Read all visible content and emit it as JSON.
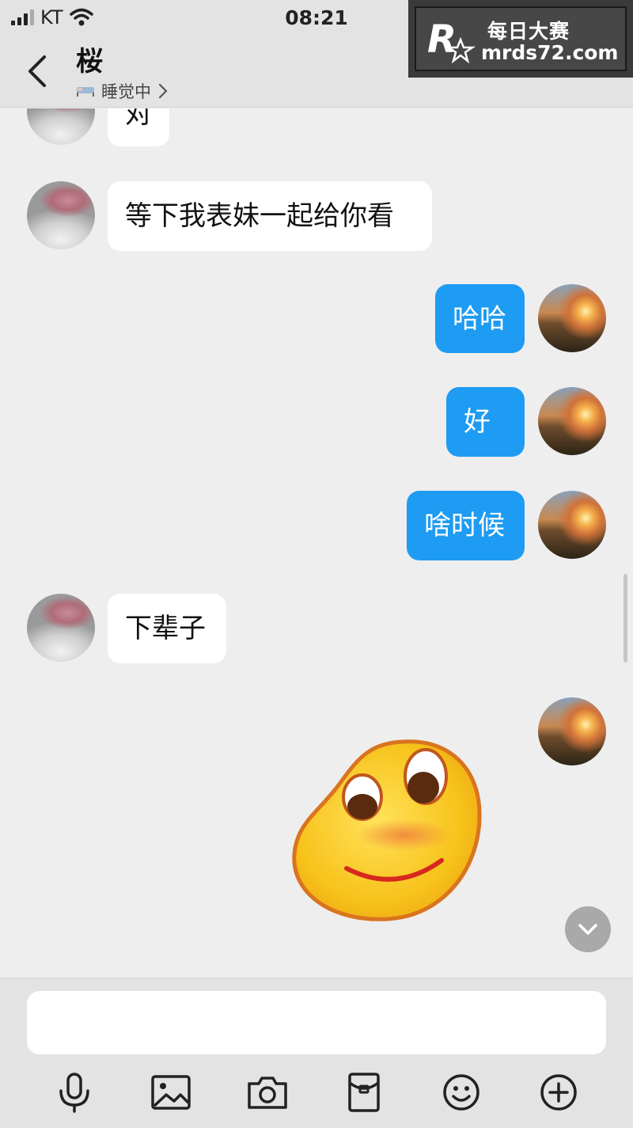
{
  "status_bar": {
    "carrier": "KT",
    "time": "08:21"
  },
  "header": {
    "contact_name": "桜",
    "contact_status": "睡觉中"
  },
  "watermark": {
    "brand_cn": "每日大赛",
    "site": "mrds72.com"
  },
  "messages": [
    {
      "side": "in",
      "text": "对",
      "partial": true
    },
    {
      "side": "in",
      "text": "等下我表妹一起给你看"
    },
    {
      "side": "out",
      "text": "哈哈"
    },
    {
      "side": "out",
      "text": "好"
    },
    {
      "side": "out",
      "text": "啥时候"
    },
    {
      "side": "in",
      "text": "下辈子"
    },
    {
      "side": "out",
      "sticker": "smiling-blob-sticker"
    }
  ],
  "composer": {
    "value": "",
    "placeholder": ""
  },
  "toolbar": {
    "icons": [
      "microphone-icon",
      "image-icon",
      "camera-icon",
      "red-packet-icon",
      "emoji-icon",
      "plus-icon"
    ]
  },
  "colors": {
    "accent": "#1e9bf2",
    "background": "#eeeeee",
    "bar": "#e3e3e3",
    "bubble_in": "#ffffff"
  }
}
